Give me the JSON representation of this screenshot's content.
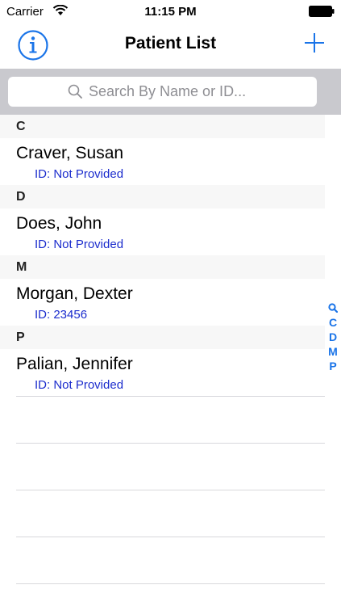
{
  "status_bar": {
    "carrier": "Carrier",
    "time": "11:15 PM"
  },
  "nav": {
    "title": "Patient List",
    "info_icon": "info-circle-icon",
    "add_icon": "plus-icon"
  },
  "search": {
    "placeholder": "Search By Name or ID..."
  },
  "sections": [
    {
      "letter": "C",
      "patients": [
        {
          "name": "Craver, Susan",
          "id": "ID: Not Provided"
        }
      ]
    },
    {
      "letter": "D",
      "patients": [
        {
          "name": "Does, John",
          "id": "ID: Not Provided"
        }
      ]
    },
    {
      "letter": "M",
      "patients": [
        {
          "name": "Morgan, Dexter",
          "id": "ID: 23456"
        }
      ]
    },
    {
      "letter": "P",
      "patients": [
        {
          "name": "Palian, Jennifer",
          "id": "ID: Not Provided"
        }
      ]
    }
  ],
  "index": [
    "C",
    "D",
    "M",
    "P"
  ],
  "colors": {
    "accent": "#1a74e8",
    "id_text": "#1b2ccd",
    "search_bar_bg": "#c9c9ce",
    "section_header_bg": "#f7f7f7"
  }
}
